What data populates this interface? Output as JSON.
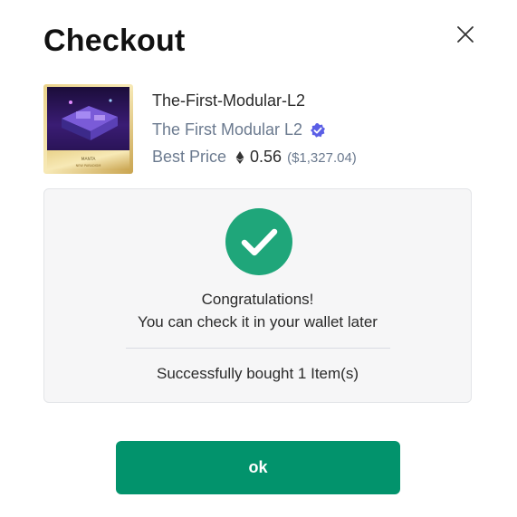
{
  "dialog": {
    "title": "Checkout"
  },
  "item": {
    "name": "The-First-Modular-L2",
    "collection": "The First Modular L2",
    "price_label": "Best Price",
    "price_eth": "0.56",
    "price_usd": "($1,327.04)",
    "thumbnail_icon": "nft-thumbnail",
    "thumbnail_caption": "MANTA",
    "thumbnail_subcaption": "NEW PARADIGM"
  },
  "result": {
    "congrats": "Congratulations!",
    "wallet_note": "You can check it in your wallet later",
    "success": "Successfully bought 1 Item(s)"
  },
  "actions": {
    "ok_label": "ok"
  },
  "colors": {
    "accent_green": "#02936c",
    "check_circle": "#1fa67a",
    "verified_badge": "#5b5fe6",
    "muted_text": "#6b7a8f"
  },
  "icons": {
    "close": "close-icon",
    "verified": "verified-badge-icon",
    "eth": "eth-icon",
    "success": "checkmark-circle-icon"
  }
}
